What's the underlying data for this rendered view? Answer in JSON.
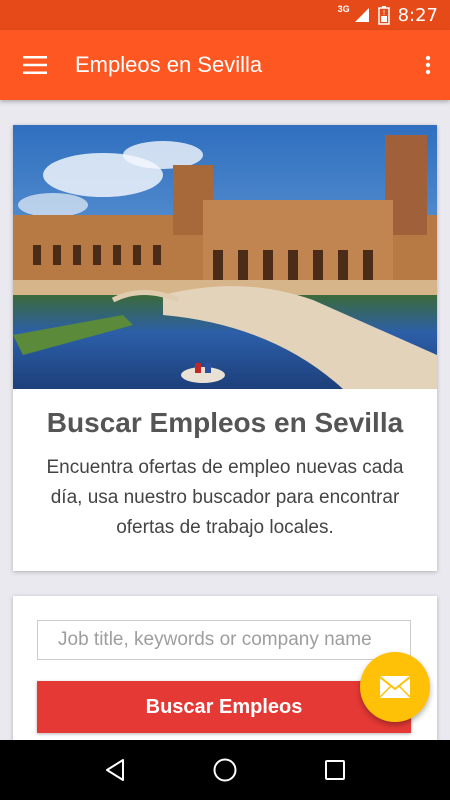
{
  "status_bar": {
    "network": "3G",
    "time": "8:27"
  },
  "app_bar": {
    "title": "Empleos en Sevilla",
    "menu_icon": "hamburger-menu-icon",
    "more_icon": "more-vert-icon"
  },
  "hero": {
    "title": "Buscar Empleos en Sevilla",
    "description": "Encuentra ofertas de empleo nuevas cada día, usa nuestro buscador para encontrar ofertas de trabajo locales."
  },
  "search": {
    "placeholder": "Job title, keywords or company name",
    "value": "",
    "button_label": "Buscar Empleos"
  },
  "fab": {
    "icon": "mail-icon"
  },
  "nav": {
    "back_icon": "back-icon",
    "home_icon": "home-icon",
    "recents_icon": "recents-icon"
  },
  "colors": {
    "primary": "#ff5722",
    "status": "#e64a19",
    "button": "#e53935",
    "fab": "#ffc107"
  }
}
